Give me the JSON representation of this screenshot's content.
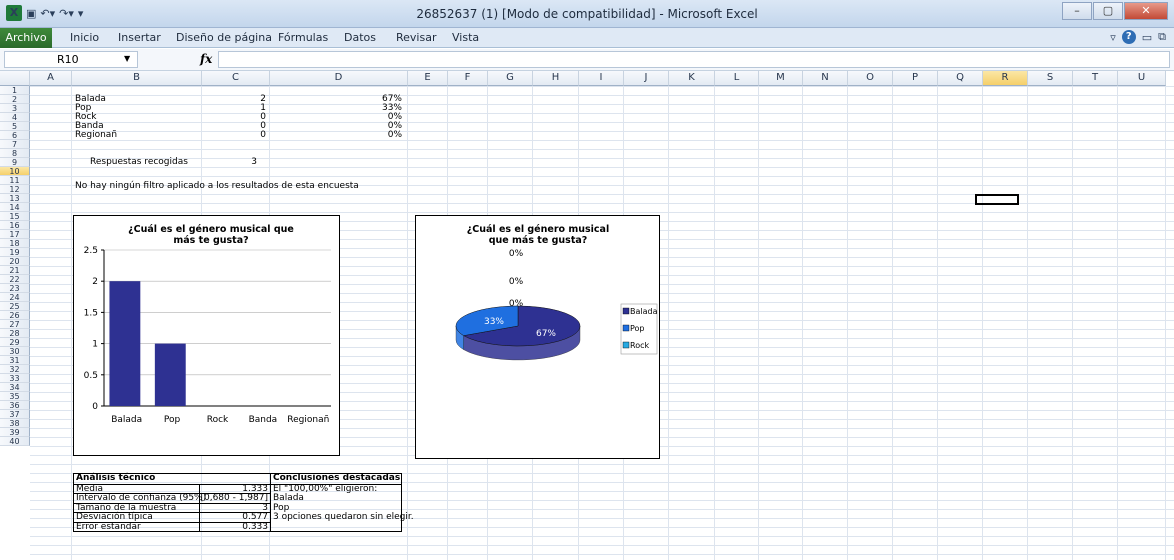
{
  "window": {
    "title": "26852637 (1)  [Modo de compatibilidad]  -  Microsoft Excel",
    "min": "–",
    "max": "▢",
    "close": "✕"
  },
  "ribbon": {
    "file_tab": "Archivo",
    "tabs": [
      "Inicio",
      "Insertar",
      "Diseño de página",
      "Fórmulas",
      "Datos",
      "Revisar",
      "Vista"
    ]
  },
  "formula_bar": {
    "name_box": "R10",
    "fx": "fx",
    "formula": ""
  },
  "columns": [
    "A",
    "B",
    "C",
    "D",
    "E",
    "F",
    "G",
    "H",
    "I",
    "J",
    "K",
    "L",
    "M",
    "N",
    "O",
    "P",
    "Q",
    "R",
    "S",
    "T",
    "U"
  ],
  "selected_column": "R",
  "selected_row": "10",
  "rows": [
    "1",
    "2",
    "3",
    "4",
    "5",
    "6",
    "7",
    "8",
    "9",
    "10",
    "11",
    "12",
    "13",
    "14",
    "15",
    "16",
    "17",
    "18",
    "19",
    "20",
    "21",
    "22",
    "23",
    "24",
    "25",
    "26",
    "27",
    "28",
    "29",
    "30",
    "31",
    "32",
    "33",
    "34",
    "35",
    "36",
    "37",
    "38",
    "39",
    "40"
  ],
  "sheet": {
    "responses": [
      {
        "label": "Balada",
        "count": "2",
        "pct": "67%"
      },
      {
        "label": "Pop",
        "count": "1",
        "pct": "33%"
      },
      {
        "label": "Rock",
        "count": "0",
        "pct": "0%"
      },
      {
        "label": "Banda",
        "count": "0",
        "pct": "0%"
      },
      {
        "label": "Regionañ",
        "count": "0",
        "pct": "0%"
      }
    ],
    "total_label": "Respuestas recogidas",
    "total_value": "3",
    "filter_note": "No hay ningún filtro aplicado a los resultados de esta encuesta"
  },
  "analysis": {
    "left_header": "Análisis técnico",
    "right_header": "Conclusiones destacadas",
    "rows": [
      {
        "label": "Media",
        "value": "1.333",
        "note": "El \"100,00%\" eligieron:"
      },
      {
        "label": "Intervalo de confianza (95%)",
        "value": "[0,680 - 1,987]",
        "note": "  Balada"
      },
      {
        "label": "Tamaño de la muestra",
        "value": "3",
        "note": "  Pop"
      },
      {
        "label": "Desviación típica",
        "value": "0.577",
        "note": "3 opciones quedaron sin elegir."
      },
      {
        "label": "Error estandar",
        "value": "0.333",
        "note": ""
      }
    ]
  },
  "chart_data": [
    {
      "type": "bar",
      "title": "¿Cuál es el género musical que más te gusta?",
      "categories": [
        "Balada",
        "Pop",
        "Rock",
        "Banda",
        "Regionañ"
      ],
      "values": [
        2,
        1,
        0,
        0,
        0
      ],
      "ylim": [
        0,
        2.5
      ],
      "yticks": [
        "0",
        "0.5",
        "1",
        "1.5",
        "2",
        "2.5"
      ],
      "grid": true,
      "color": "#2e3192"
    },
    {
      "type": "pie",
      "title": "¿Cuál es el género musical que más te gusta?",
      "labels": [
        "Balada",
        "Pop",
        "Rock"
      ],
      "values": [
        67,
        33,
        0
      ],
      "data_labels": [
        "67%",
        "33%",
        "0%",
        "0%",
        "0%"
      ],
      "colors": [
        "#2e3192",
        "#1f6fe0",
        "#27a9e1"
      ],
      "legend": "right"
    }
  ]
}
